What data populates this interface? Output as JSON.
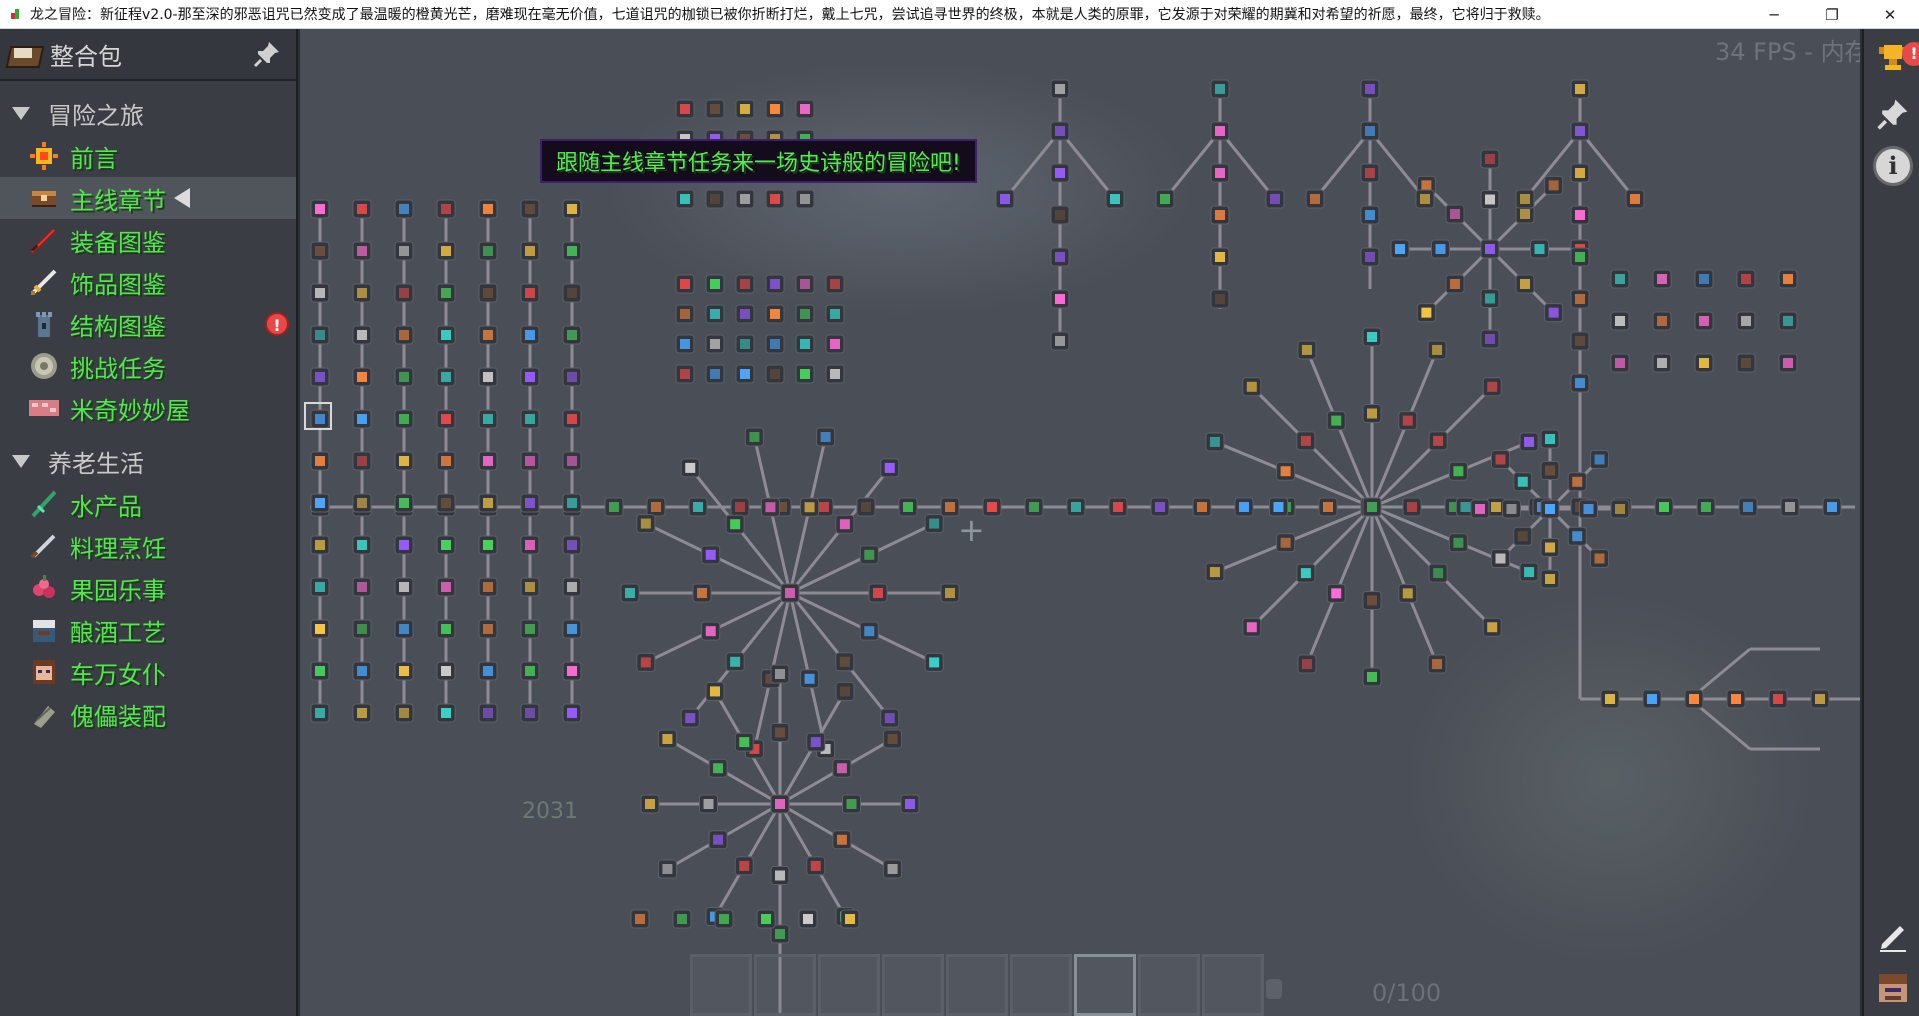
{
  "window": {
    "title": "龙之冒险：新征程v2.0-那至深的邪恶诅咒已然变成了最温暖的橙黄光芒，磨难现在毫无价值，七道诅咒的枷锁已被你折断打烂，戴上七咒，尝试追寻世界的终极，本就是人类的原罪，它发源于对荣耀的期冀和对希望的祈愿，最终，它将归于救赎。",
    "minimize_icon": "─",
    "restore_icon": "❐",
    "close_icon": "✕"
  },
  "sidebar": {
    "title": "整合包",
    "groups": [
      {
        "label": "冒险之旅",
        "items": [
          {
            "label": "前言"
          },
          {
            "label": "主线章节"
          },
          {
            "label": "装备图鉴"
          },
          {
            "label": "饰品图鉴"
          },
          {
            "label": "结构图鉴",
            "alert": "!"
          },
          {
            "label": "挑战任务"
          },
          {
            "label": "米奇妙妙屋"
          }
        ]
      },
      {
        "label": "养老生活",
        "items": [
          {
            "label": "水产品"
          },
          {
            "label": "料理烹饪"
          },
          {
            "label": "果园乐事"
          },
          {
            "label": "酿酒工艺"
          },
          {
            "label": "车万女仆"
          },
          {
            "label": "傀儡装配"
          }
        ]
      }
    ]
  },
  "canvas": {
    "fps_text": "34 FPS - 内存",
    "tooltip": "跟随主线章节任务来一场史诗般的冒险吧!",
    "ghost_number": "2031",
    "progress_text": "0/100",
    "node_colors": [
      "#f5c542",
      "#ea4a4a",
      "#4aa7ff",
      "#9a5cff",
      "#47d35b",
      "#39d0c8",
      "#ff8a3d",
      "#cfcfcf",
      "#ff6bd6",
      "#6d4f3a"
    ]
  },
  "rightbar": {
    "alert": "!",
    "info_label": "i"
  }
}
